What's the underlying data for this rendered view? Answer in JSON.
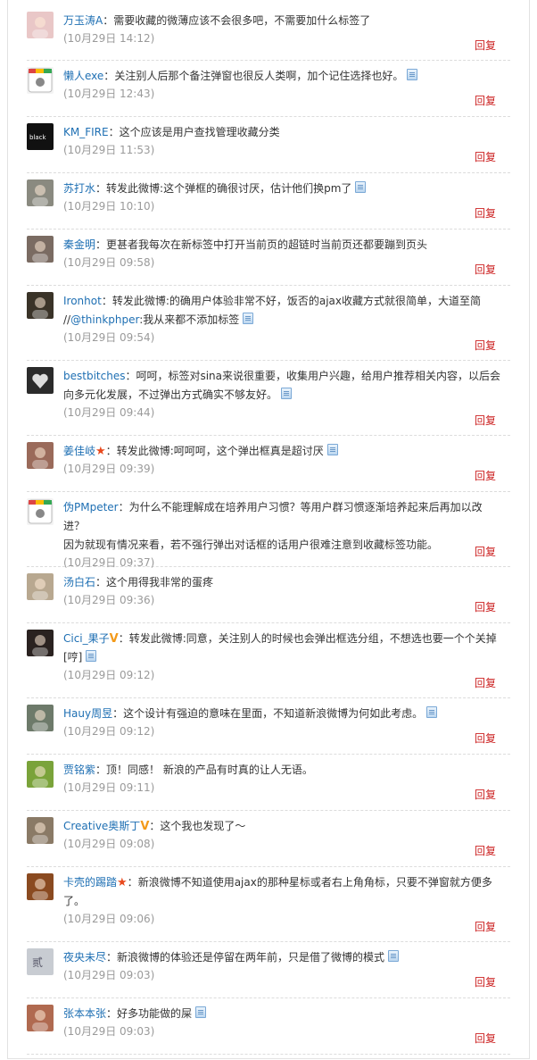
{
  "reply_label": "回复",
  "comments": [
    {
      "user": "万玉涛A",
      "text": "需要收藏的微薄应该不会很多吧，不需要加什么标签了",
      "time": "(10月29日 14:12)",
      "note": false,
      "badge": "",
      "avatar_color": "#e9c7c7",
      "avatar_icon": "cartoon-avatar"
    },
    {
      "user": "懒人exe",
      "text": "关注别人后那个备注弹窗也很反人类啊，加个记住选择也好。",
      "time": "(10月29日 12:43)",
      "note": true,
      "badge": "",
      "avatar_color": "#f3f3f3",
      "avatar_icon": "chrome-avatar"
    },
    {
      "user": "KM_FIRE",
      "text": "这个应该是用户查找管理收藏分类",
      "time": "(10月29日 11:53)",
      "note": false,
      "badge": "",
      "avatar_color": "#111111",
      "avatar_icon": "black-logo-avatar"
    },
    {
      "user": "苏打水",
      "text": "转发此微博:这个弹框的确很讨厌，估计他们换pm了",
      "time": "(10月29日 10:10)",
      "note": true,
      "badge": "",
      "avatar_color": "#8a8a80",
      "avatar_icon": "photo-avatar"
    },
    {
      "user": "秦金明",
      "text": "更甚者我每次在新标签中打开当前页的超链时当前页还都要蹦到页头",
      "time": "(10月29日 09:58)",
      "note": false,
      "badge": "",
      "avatar_color": "#7a6b62",
      "avatar_icon": "photo-avatar"
    },
    {
      "user": "Ironhot",
      "text": "转发此微博:的确用户体验非常不好，饭否的ajax收藏方式就很简单，大道至简",
      "text2_prefix": "//",
      "text2_user": "@thinkphper",
      "text2": ":我从来都不添加标签",
      "time": "(10月29日 09:54)",
      "note": true,
      "badge": "",
      "avatar_color": "#3a3328",
      "avatar_icon": "photo-avatar"
    },
    {
      "user": "bestbitches",
      "text": "呵呵，标签对sina来说很重要，收集用户兴趣，给用户推荐相关内容，以后会",
      "text2": "向多元化发展，不过弹出方式确实不够友好。",
      "time": "(10月29日 09:44)",
      "note": true,
      "badge": "",
      "avatar_color": "#2b2b2b",
      "avatar_icon": "heart-avatar"
    },
    {
      "user": "姜佳岐",
      "text": "转发此微博:呵呵呵，这个弹出框真是超讨厌",
      "time": "(10月29日 09:39)",
      "note": true,
      "badge": "star",
      "avatar_color": "#9a6a5a",
      "avatar_icon": "photo-avatar"
    },
    {
      "user": "伪PMpeter",
      "text": "为什么不能理解成在培养用户习惯？等用户群习惯逐渐培养起来后再加以改进？",
      "text2": "因为就现有情况来看，若不强行弹出对话框的话用户很难注意到收藏标签功能。",
      "time": "(10月29日 09:37)",
      "note": false,
      "badge": "",
      "avatar_color": "#f3f3f3",
      "avatar_icon": "chrome-avatar"
    },
    {
      "user": "汤白石",
      "text": "这个用得我非常的蛋疼",
      "time": "(10月29日 09:36)",
      "note": false,
      "badge": "",
      "avatar_color": "#b8a890",
      "avatar_icon": "dog-avatar"
    },
    {
      "user": "Cici_果子",
      "text": "转发此微博:同意，关注别人的时候也会弹出框选分组，不想选也要一个个关掉",
      "text2": "[哼]",
      "time": "(10月29日 09:12)",
      "note": true,
      "badge": "v",
      "avatar_color": "#2a2220",
      "avatar_icon": "photo-avatar"
    },
    {
      "user": "Hauy周昱",
      "text": "这个设计有强迫的意味在里面，不知道新浪微博为何如此考虑。",
      "time": "(10月29日 09:12)",
      "note": true,
      "badge": "",
      "avatar_color": "#6d7a6a",
      "avatar_icon": "photo-avatar"
    },
    {
      "user": "贾铭紫",
      "text": "顶！同感！ 新浪的产品有时真的让人无语。",
      "time": "(10月29日 09:11)",
      "note": false,
      "badge": "",
      "avatar_color": "#7aa33a",
      "avatar_icon": "chipmunk-avatar"
    },
    {
      "user": "Creative奥斯丁",
      "text": "这个我也发现了～",
      "time": "(10月29日 09:08)",
      "note": false,
      "badge": "v",
      "avatar_color": "#8a7a66",
      "avatar_icon": "photo-avatar"
    },
    {
      "user": "卡壳的踢踏",
      "text": "新浪微博不知道使用ajax的那种星标或者右上角角标，只要不弹窗就方便多",
      "text2": "了。",
      "time": "(10月29日 09:06)",
      "note": false,
      "badge": "star",
      "avatar_color": "#8a4a20",
      "avatar_icon": "dog-avatar"
    },
    {
      "user": "夜央未尽",
      "text": "新浪微博的体验还是停留在两年前，只是借了微博的模式",
      "time": "(10月29日 09:03)",
      "note": true,
      "badge": "",
      "avatar_color": "#c8ccd2",
      "avatar_icon": "text-avatar"
    },
    {
      "user": "张本本张",
      "text": "好多功能做的屎",
      "time": "(10月29日 09:03)",
      "note": true,
      "badge": "",
      "avatar_color": "#b06a50",
      "avatar_icon": "photo-avatar"
    }
  ]
}
